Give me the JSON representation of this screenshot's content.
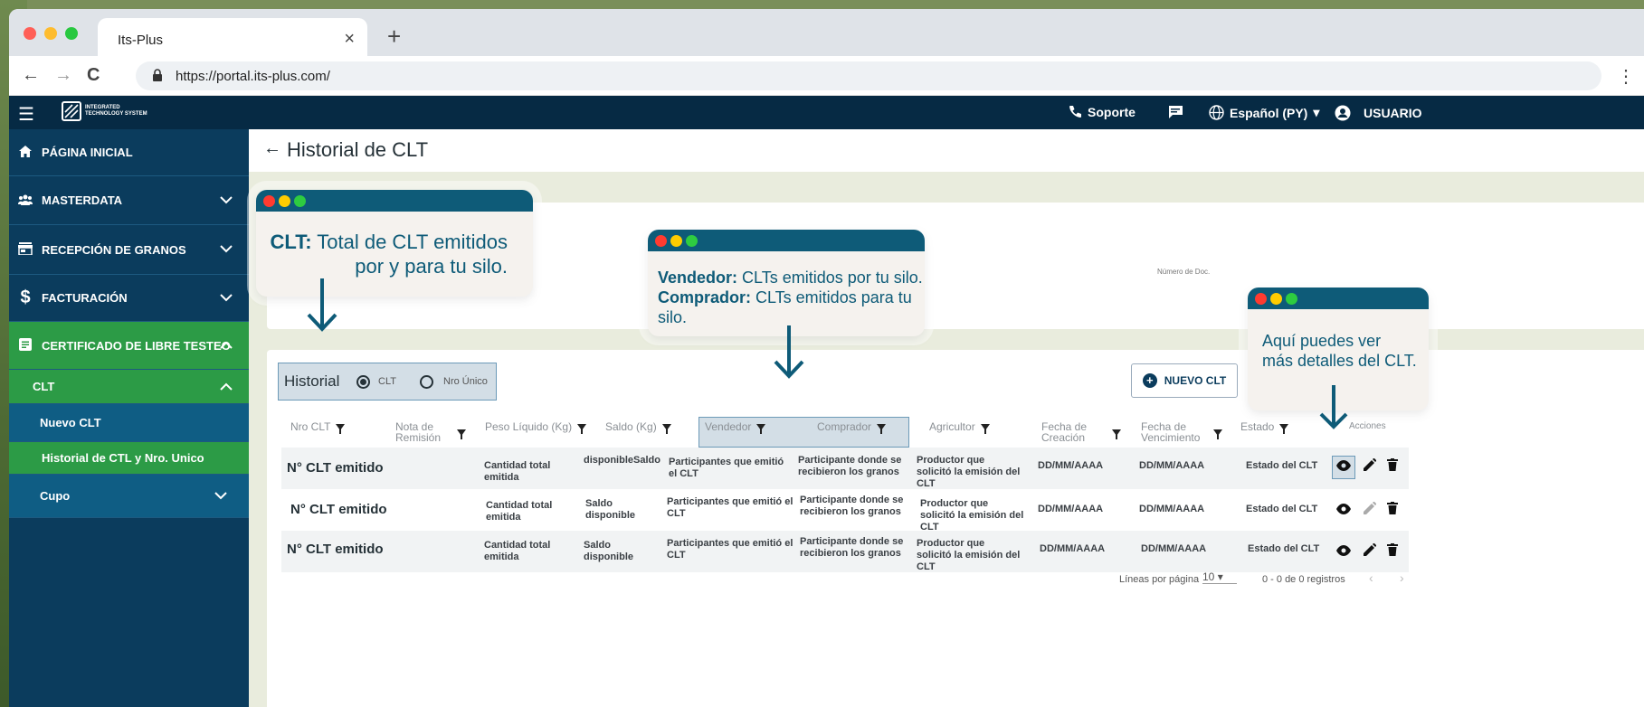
{
  "browser": {
    "tab_title": "Its-Plus",
    "tab_close": "×",
    "new_tab": "+",
    "url": "https://portal.its-plus.com/",
    "back": "←",
    "forward": "→",
    "reload": "C",
    "menu": "⋮",
    "dot_colors": [
      "#ff5f57",
      "#febc2e",
      "#28c840"
    ]
  },
  "header": {
    "logo_text_1": "INTEGRATED",
    "logo_text_2": "TECHNOLOGY SYSTEM",
    "soporte": "Soporte",
    "idioma": "Español (PY)",
    "usuario": "USUARIO"
  },
  "sidebar": {
    "items": [
      {
        "label": "PÁGINA INICIAL",
        "icon": "home-icon"
      },
      {
        "label": "MASTERDATA",
        "icon": "users-icon"
      },
      {
        "label": "RECEPCIÓN DE GRANOS",
        "icon": "store-icon"
      },
      {
        "label": "FACTURACIÓN",
        "icon": "dollar-icon"
      },
      {
        "label": "CERTIFICADO DE LIBRE TESTEO",
        "icon": "document-icon"
      },
      {
        "label": "CLT"
      },
      {
        "label": "Nuevo CLT"
      },
      {
        "label": "Historial de CTL y Nro. Unico"
      },
      {
        "label": "Cupo"
      }
    ]
  },
  "page": {
    "title": "Historial de CLT",
    "numero_doc": "Número de Doc.",
    "historial_label": "Historial",
    "radio_clt": "CLT",
    "radio_nro": "Nro Único",
    "nuevo_clt": "NUEVO CLT"
  },
  "table": {
    "headers": [
      "Nro CLT",
      "Nota de Remisión",
      "Peso Líquido (Kg)",
      "Saldo (Kg)",
      "Vendedor",
      "Comprador",
      "Agricultor",
      "Fecha de Creación",
      "Fecha de Vencimiento",
      "Estado",
      "Acciones"
    ],
    "rows": [
      [
        "N° CLT emitido",
        "Cantidad total emitida",
        "disponibleSaldo",
        "Participantes que emitió el CLT",
        "Participante donde se recibieron los granos",
        "Productor que solicitó la emisión del CLT",
        "DD/MM/AAAA",
        "DD/MM/AAAA",
        "Estado del CLT"
      ],
      [
        "N° CLT emitido",
        "Cantidad total emitida",
        "Saldo disponible",
        "Participantes que emitió el CLT",
        "Participante donde se recibieron los granos",
        "Productor que solicitó la emisión del CLT",
        "DD/MM/AAAA",
        "DD/MM/AAAA",
        "Estado del CLT"
      ],
      [
        "N° CLT emitido",
        "Cantidad total emitida",
        "Saldo disponible",
        "Participantes que emitió el CLT",
        "Participante donde se recibieron los granos",
        "Productor que solicitó la emisión del CLT",
        "DD/MM/AAAA",
        "DD/MM/AAAA",
        "Estado del CLT"
      ]
    ],
    "pager_label": "Líneas por página",
    "pager_value": "10",
    "pager_range": "0 - 0 de 0 registros"
  },
  "tooltips": {
    "clt_bold": "CLT:",
    "clt_text_1": " Total de CLT emitidos",
    "clt_text_2": "por y para tu silo.",
    "vend_bold": "Vendedor:",
    "vend_text": " CLTs emitidos por tu silo.",
    "comp_bold": "Comprador:",
    "comp_text": " CLTs emitidos para tu silo.",
    "detail_1": "Aquí puedes ver",
    "detail_2": "más detalles del CLT."
  },
  "colors": {
    "header_bg": "#062a44",
    "sidebar_bg": "#0b3c5d",
    "active_green": "#2c9b46",
    "tooltip_accent": "#0e5b78"
  }
}
